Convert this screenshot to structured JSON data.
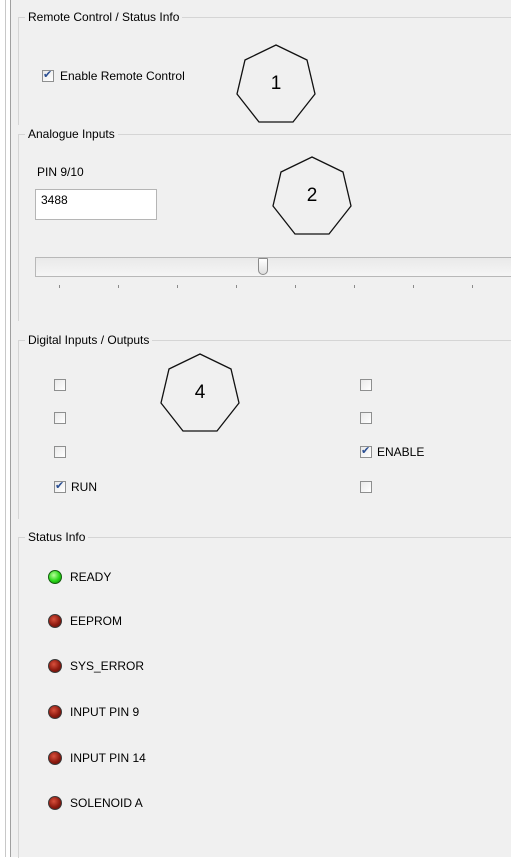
{
  "remote_control": {
    "title": "Remote Control / Status Info",
    "enable_label": "Enable Remote Control",
    "enable_checked": true,
    "callout": "1"
  },
  "analogue_inputs": {
    "title": "Analogue Inputs",
    "pin_label": "PIN 9/10",
    "pin_value": "3488",
    "slider_fraction": 0.47,
    "callout": "2"
  },
  "digital_io": {
    "title": "Digital Inputs / Outputs",
    "callout": "4",
    "left_items": [
      {
        "label": "",
        "checked": false
      },
      {
        "label": "",
        "checked": false
      },
      {
        "label": "",
        "checked": false
      },
      {
        "label": "RUN",
        "checked": true
      }
    ],
    "right_items": [
      {
        "label": "",
        "checked": false
      },
      {
        "label": "",
        "checked": false
      },
      {
        "label": "ENABLE",
        "checked": true
      },
      {
        "label": "",
        "checked": false
      }
    ]
  },
  "status_info": {
    "title": "Status Info",
    "items": [
      {
        "label": "READY",
        "state": "green"
      },
      {
        "label": "EEPROM",
        "state": "red"
      },
      {
        "label": "SYS_ERROR",
        "state": "red"
      },
      {
        "label": "INPUT PIN 9",
        "state": "red"
      },
      {
        "label": "INPUT PIN 14",
        "state": "red"
      },
      {
        "label": "SOLENOID A",
        "state": "red"
      }
    ]
  }
}
